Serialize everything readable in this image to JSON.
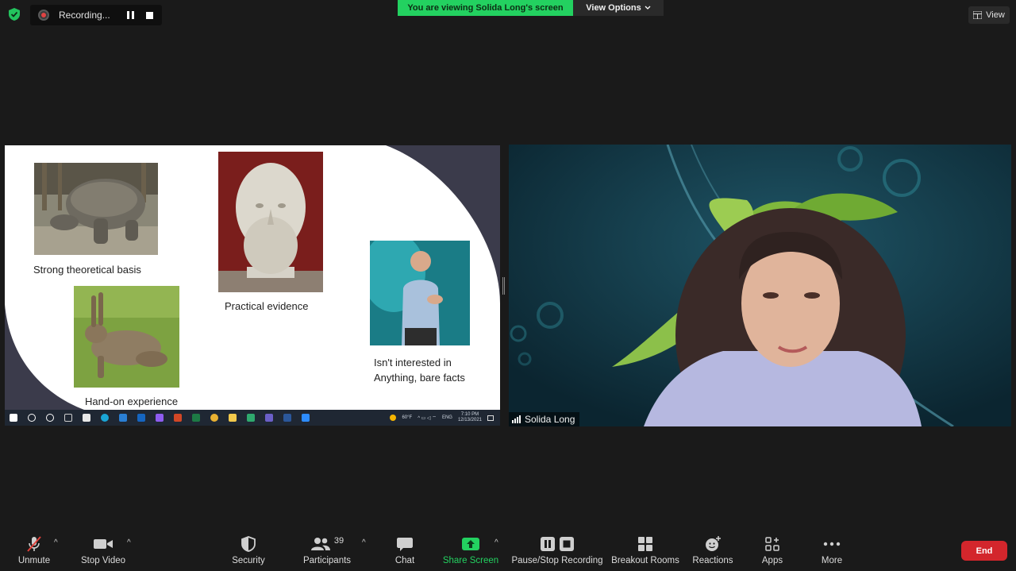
{
  "top": {
    "recording_label": "Recording...",
    "viewing_banner": "You are viewing Solida Long's screen",
    "view_options": "View Options",
    "view_button": "View"
  },
  "slide": {
    "label_tortoise": "Strong theoretical basis",
    "label_bust": "Practical evidence",
    "label_hare": "Hand-on experience",
    "label_person_line1": "Isn't interested in",
    "label_person_line2": "Anything, bare facts",
    "taskbar": {
      "weather": "60°F",
      "lang": "ENG",
      "time": "7:10 PM",
      "date": "12/13/2021"
    }
  },
  "participant": {
    "name": "Solida Long"
  },
  "toolbar": {
    "unmute": "Unmute",
    "stop_video": "Stop Video",
    "security": "Security",
    "participants": "Participants",
    "participants_count": "39",
    "chat": "Chat",
    "share_screen": "Share Screen",
    "pause_stop_recording": "Pause/Stop Recording",
    "breakout_rooms": "Breakout Rooms",
    "reactions": "Reactions",
    "apps": "Apps",
    "more": "More",
    "end": "End"
  },
  "colors": {
    "share_green": "#23d160",
    "end_red": "#d3262c",
    "background": "#1a1a1a"
  }
}
